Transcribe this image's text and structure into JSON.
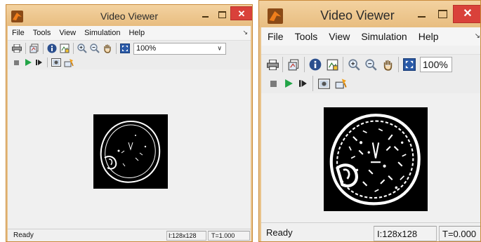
{
  "windows": [
    {
      "title": "Video Viewer",
      "menu": [
        "File",
        "Tools",
        "View",
        "Simulation",
        "Help"
      ],
      "menu_overflow": "↘",
      "zoom": "100%",
      "status": {
        "text": "Ready",
        "size": "I:128x128",
        "time": "T=1.000"
      }
    },
    {
      "title": "Video Viewer",
      "menu": [
        "File",
        "Tools",
        "View",
        "Simulation",
        "Help"
      ],
      "menu_overflow": "↘",
      "zoom": "100%",
      "status": {
        "text": "Ready",
        "size": "I:128x128",
        "time": "T=0.000"
      }
    }
  ],
  "colors": {
    "title_bar": "#e9c38a",
    "close_button": "#d9413a",
    "client": "#f0f0f0",
    "play": "#22a447",
    "image_bg": "#000000"
  },
  "icons": [
    "matlab-icon",
    "minimize-icon",
    "maximize-icon",
    "close-icon",
    "print-icon",
    "new-window-icon",
    "info-icon",
    "properties-icon",
    "zoom-in-icon",
    "zoom-out-icon",
    "pan-icon",
    "fit-icon",
    "stop-icon",
    "play-icon",
    "step-forward-icon",
    "snapshot-icon",
    "highlight-icon"
  ]
}
